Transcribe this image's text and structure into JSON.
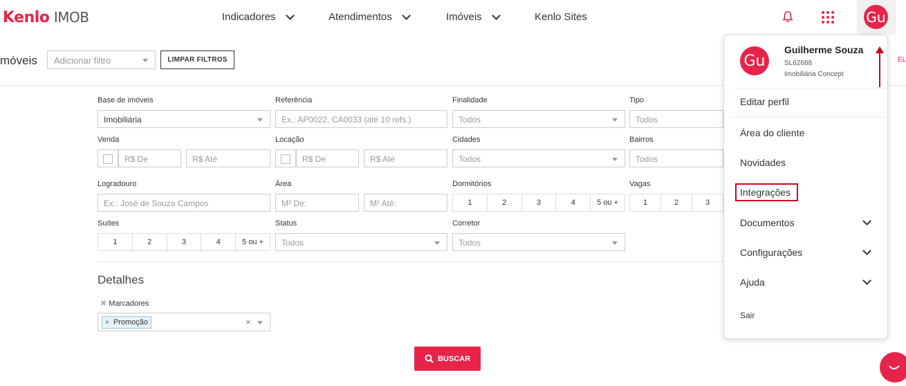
{
  "header": {
    "logo_brand": "Kenlo",
    "logo_product": "IMOB",
    "nav": [
      {
        "label": "Indicadores"
      },
      {
        "label": "Atendimentos"
      },
      {
        "label": "Imóveis"
      },
      {
        "label": "Kenlo Sites"
      }
    ],
    "avatar_initials": "Gu"
  },
  "subbar": {
    "page_title": "móveis",
    "filter_placeholder": "Adicionar filtro",
    "clear_filters_label": "LIMPAR FILTROS",
    "excel_fragment": "EL"
  },
  "filters": {
    "base_label": "Base de imóveis",
    "base_value": "Imobiliária",
    "referencia_label": "Referência",
    "referencia_placeholder": "Ex.: AP0022, CA0033 (até 10 refs.)",
    "finalidade_label": "Finalidade",
    "finalidade_value": "Todos",
    "tipo_label": "Tipo",
    "tipo_value": "Todos",
    "venda_label": "Venda",
    "venda_de": "R$ De",
    "venda_ate": "R$ Até",
    "locacao_label": "Locação",
    "locacao_de": "R$ De",
    "locacao_ate": "R$ Até",
    "cidades_label": "Cidades",
    "cidades_value": "Todos",
    "bairros_label": "Bairros",
    "bairros_value": "Todos",
    "logradouro_label": "Logradouro",
    "logradouro_placeholder": "Ex.: José de Souza Campos",
    "area_label": "Área",
    "area_de": "M² De:",
    "area_ate": "M² Até:",
    "dormitorios_label": "Dormitórios",
    "dormitorios_options": [
      "1",
      "2",
      "3",
      "4",
      "5 ou +"
    ],
    "vagas_label": "Vagas",
    "vagas_options": [
      "1",
      "2",
      "3"
    ],
    "suites_label": "Suítes",
    "suites_options": [
      "1",
      "2",
      "3",
      "4",
      "5 ou +"
    ],
    "status_label": "Status",
    "status_value": "Todos",
    "corretor_label": "Corretor",
    "corretor_value": "Todos"
  },
  "details": {
    "title": "Detalhes",
    "marcadores_label": "Marcadores",
    "tag": "Promoção"
  },
  "search_button": "BUSCAR",
  "user_menu": {
    "initials": "Gu",
    "name": "Guilherme Souza",
    "code": "SL62688",
    "agency": "Imobiliária Concept",
    "items": [
      {
        "label": "Editar perfil"
      },
      {
        "label": "Área do cliente"
      },
      {
        "label": "Novidades"
      },
      {
        "label": "Integrações"
      },
      {
        "label": "Documentos"
      },
      {
        "label": "Configurações"
      },
      {
        "label": "Ajuda"
      },
      {
        "label": "Sair"
      }
    ]
  },
  "colors": {
    "accent": "#e8234a",
    "annotation": "#d0021b"
  }
}
